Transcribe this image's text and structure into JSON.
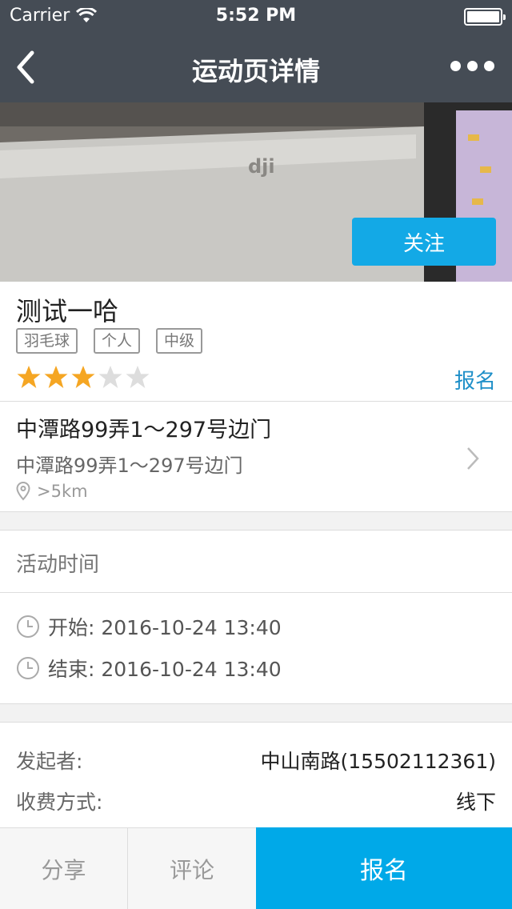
{
  "status": {
    "carrier": "Carrier",
    "time": "5:52 PM"
  },
  "nav": {
    "title": "运动页详情"
  },
  "hero": {
    "follow_label": "关注"
  },
  "event": {
    "title": "测试一哈",
    "tags": [
      "羽毛球",
      "个人",
      "中级"
    ],
    "rating": 3,
    "rating_max": 5,
    "signup_link": "报名"
  },
  "address": {
    "main": "中潭路99弄1～297号边门",
    "sub": "中潭路99弄1～297号边门",
    "distance": ">5km"
  },
  "time_section": {
    "header": "活动时间",
    "start": "开始: 2016-10-24 13:40",
    "end": "结束: 2016-10-24 13:40"
  },
  "info": {
    "organizer_label": "发起者:",
    "organizer_value": "中山南路(15502112361)",
    "fee_label": "收费方式:",
    "fee_value": "线下"
  },
  "toolbar": {
    "share": "分享",
    "comment": "评论",
    "signup": "报名"
  },
  "colors": {
    "nav_bg": "#454c55",
    "accent": "#00a9e8",
    "star_on": "#f5a623",
    "star_off": "#dddddd"
  }
}
